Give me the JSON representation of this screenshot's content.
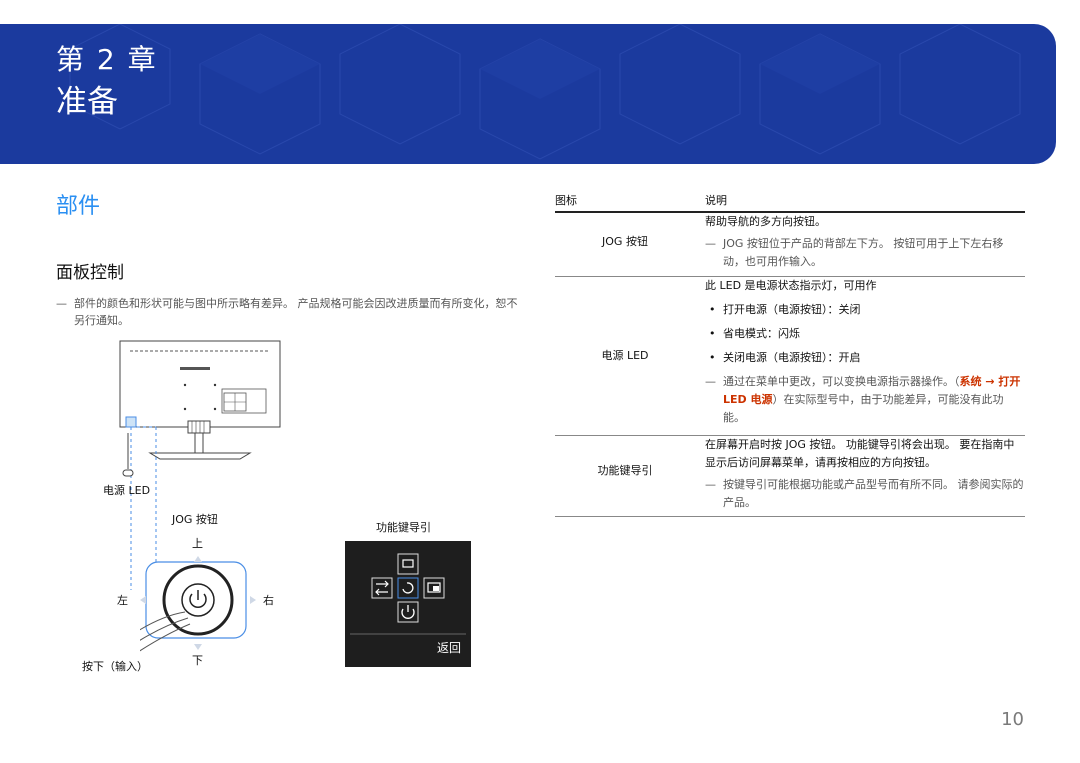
{
  "header": {
    "chapter": "第 2 章",
    "title": "准备"
  },
  "section_title": "部件",
  "subsection_title": "面板控制",
  "note": {
    "dash": "—",
    "text": "部件的颜色和形状可能与图中所示略有差异。 产品规格可能会因改进质量而有所变化，恕不另行通知。"
  },
  "figure": {
    "power_led": "电源 LED",
    "jog_button": "JOG 按钮",
    "up": "上",
    "down": "下",
    "left": "左",
    "right": "右",
    "press": "按下（输入）",
    "function_key_guide": "功能键导引",
    "return": "返回"
  },
  "table": {
    "col_icon": "图标",
    "col_desc": "说明",
    "rows": [
      {
        "name": "JOG 按钮",
        "main": "帮助导航的多方向按钮。",
        "note": "JOG 按钮位于产品的背部左下方。 按钮可用于上下左右移动，也可用作输入。"
      },
      {
        "name": "电源 LED",
        "main": "此 LED 是电源状态指示灯，可用作",
        "bullets": [
          "打开电源（电源按钮）：关闭",
          "省电模式：闪烁",
          "关闭电源（电源按钮）：开启"
        ],
        "note_pre": "通过在菜单中更改，可以变换电源指示器操作。（",
        "note_red": "系统 → 打开 LED 电源",
        "note_post": "）在实际型号中，由于功能差异，可能没有此功能。"
      },
      {
        "name": "功能键导引",
        "main": "在屏幕开启时按 JOG 按钮。 功能键导引将会出现。 要在指南中显示后访问屏幕菜单，请再按相应的方向按钮。",
        "note": "按键导引可能根据功能或产品型号而有所不同。 请参阅实际的产品。"
      }
    ]
  },
  "page_number": "10",
  "colors": {
    "banner": "#1b3a9e",
    "section": "#2a8ff2",
    "highlight": "#cc3300"
  }
}
